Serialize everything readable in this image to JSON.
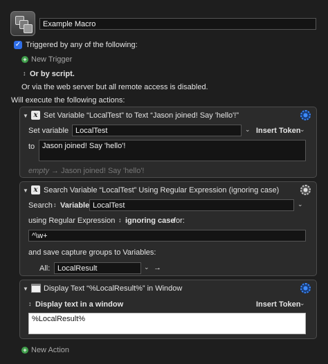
{
  "macro": {
    "name": "Example Macro"
  },
  "triggers": {
    "checked": true,
    "label": "Triggered by any of the following:",
    "new_trigger": "New Trigger",
    "or_by_script": "Or by script.",
    "web_server_note": "Or via the web server but all remote access is disabled."
  },
  "actions_header": "Will execute the following actions:",
  "action1": {
    "title": "Set Variable “LocalTest” to Text “Jason joined! Say 'hello'!”",
    "set_variable_label": "Set variable",
    "variable_name": "LocalTest",
    "insert_token": "Insert Token",
    "to_label": "to",
    "text_value": "Jason joined! Say 'hello'!",
    "preview_empty": "empty",
    "preview_arrow": "→",
    "preview_result": "Jason joined! Say 'hello'!"
  },
  "action2": {
    "title": "Search Variable “LocalTest” Using Regular Expression (ignoring case)",
    "search_label": "Search",
    "source_type": "Variable",
    "variable_name": "LocalTest",
    "using_label": "using Regular Expression",
    "case_option": "ignoring case",
    "for_label": "for:",
    "regex": "^\\w+",
    "capture_label": "and save capture groups to Variables:",
    "all_label": "All:",
    "capture_var": "LocalResult",
    "arrow": "→"
  },
  "action3": {
    "title": "Display Text “%LocalResult%” in Window",
    "display_option": "Display text in a window",
    "insert_token": "Insert Token",
    "text_value": "%LocalResult%"
  },
  "new_action": "New Action",
  "icons": {
    "check": "✓",
    "plus": "+",
    "updown": "↕",
    "triangle": "▼",
    "chevron": "⌄",
    "x_glyph": "x"
  }
}
